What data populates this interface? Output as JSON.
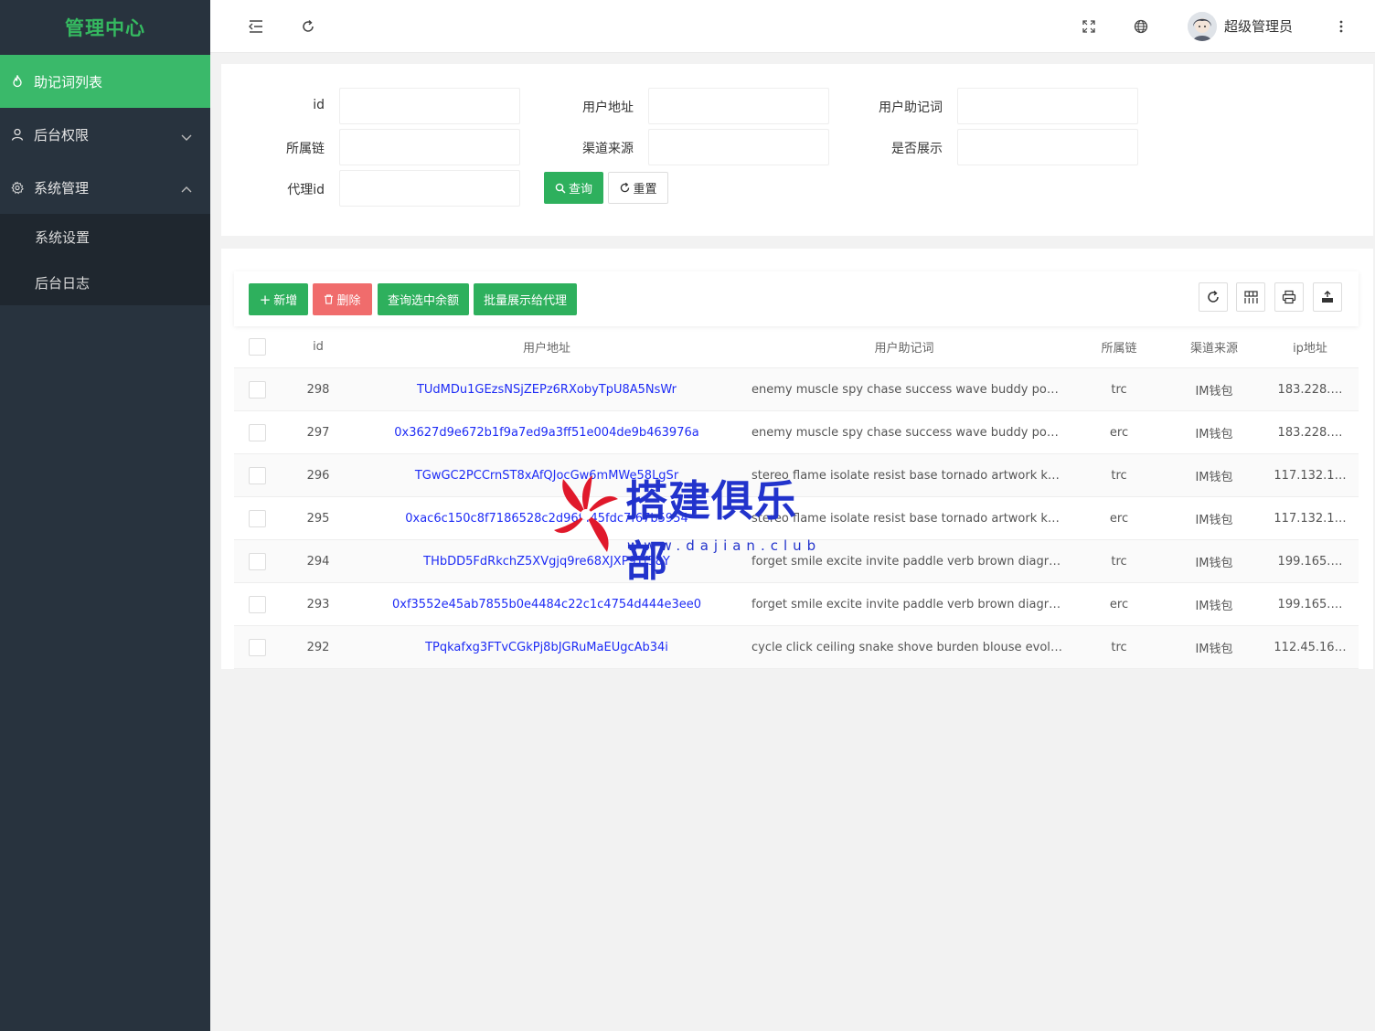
{
  "sidebar": {
    "brand": "管理中心",
    "items": [
      {
        "label": "助记词列表",
        "icon": "fire-icon",
        "active": true
      },
      {
        "label": "后台权限",
        "icon": "user-icon",
        "expanded": false
      },
      {
        "label": "系统管理",
        "icon": "gear-icon",
        "expanded": true
      }
    ],
    "sub_items": [
      {
        "label": "系统设置"
      },
      {
        "label": "后台日志"
      }
    ]
  },
  "header": {
    "icons": [
      "menu-fold-icon",
      "refresh-icon",
      "fullscreen-icon",
      "globe-icon",
      "more-icon"
    ],
    "user_name": "超级管理员"
  },
  "search": {
    "fields": [
      {
        "label": "id",
        "value": ""
      },
      {
        "label": "用户地址",
        "value": ""
      },
      {
        "label": "用户助记词",
        "value": ""
      },
      {
        "label": "所属链",
        "value": ""
      },
      {
        "label": "渠道来源",
        "value": ""
      },
      {
        "label": "是否展示",
        "value": ""
      },
      {
        "label": "代理id",
        "value": ""
      }
    ],
    "query_label": "查询",
    "reset_label": "重置"
  },
  "toolbar": {
    "add_label": "新增",
    "delete_label": "删除",
    "query_balance_label": "查询选中余额",
    "batch_show_label": "批量展示给代理",
    "right_icons": [
      "refresh-icon",
      "columns-icon",
      "print-icon",
      "export-icon"
    ]
  },
  "table": {
    "columns": [
      "id",
      "用户地址",
      "用户助记词",
      "所属链",
      "渠道来源",
      "ip地址"
    ],
    "rows": [
      {
        "id": "298",
        "address": "TUdMDu1GEzsNSjZEPz6RXobyTpU8A5NsWr",
        "mnemonic": "enemy muscle spy chase success wave buddy pover…",
        "chain": "trc",
        "source": "IM钱包",
        "ip": "183.228.…"
      },
      {
        "id": "297",
        "address": "0x3627d9e672b1f9a7ed9a3ff51e004de9b463976a",
        "mnemonic": "enemy muscle spy chase success wave buddy pover…",
        "chain": "erc",
        "source": "IM钱包",
        "ip": "183.228.…"
      },
      {
        "id": "296",
        "address": "TGwGC2PCCrnST8xAfQJocGw6mMWe58LgSr",
        "mnemonic": "stereo flame isolate resist base tornado artwork kiss …",
        "chain": "trc",
        "source": "IM钱包",
        "ip": "117.132.1…"
      },
      {
        "id": "295",
        "address": "0xac6c150c8f7186528c2d96f445fdc7f67b5954",
        "mnemonic": "stereo flame isolate resist base tornado artwork kiss …",
        "chain": "erc",
        "source": "IM钱包",
        "ip": "117.132.1…"
      },
      {
        "id": "294",
        "address": "THbDD5FdRkchZ5XVgjq9re68XJXP9Tf58Y",
        "mnemonic": "forget smile excite invite paddle verb brown diagram …",
        "chain": "trc",
        "source": "IM钱包",
        "ip": "199.165.…"
      },
      {
        "id": "293",
        "address": "0xf3552e45ab7855b0e4484c22c1c4754d444e3ee0",
        "mnemonic": "forget smile excite invite paddle verb brown diagram …",
        "chain": "erc",
        "source": "IM钱包",
        "ip": "199.165.…"
      },
      {
        "id": "292",
        "address": "TPqkafxg3FTvCGkPj8bJGRuMaEUgcAb34i",
        "mnemonic": "cycle click ceiling snake shove burden blouse evolve …",
        "chain": "trc",
        "source": "IM钱包",
        "ip": "112.45.16…"
      }
    ]
  },
  "watermark": {
    "title": "搭建俱乐部",
    "url": "www.dajian.club"
  },
  "colors": {
    "sidebar_bg": "#28333e",
    "accent_green": "#3ab96a",
    "danger_red": "#f06c6c",
    "link_blue": "#1e2cf5"
  }
}
